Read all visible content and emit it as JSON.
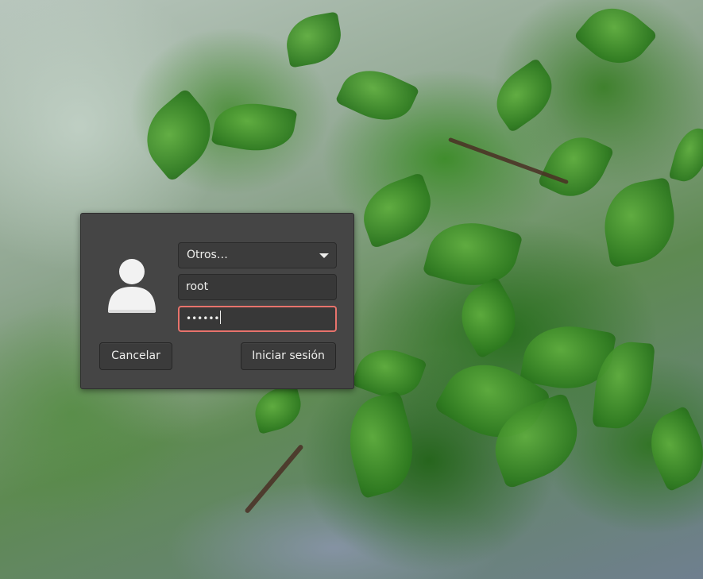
{
  "login_dialog": {
    "user_select": {
      "selected": "Otros…"
    },
    "username_field": {
      "value": "root"
    },
    "password_field": {
      "masked_value": "••••••"
    },
    "cancel_label": "Cancelar",
    "login_label": "Iniciar sesión"
  },
  "icons": {
    "avatar": "user-avatar-icon",
    "dropdown": "chevron-down-icon"
  },
  "colors": {
    "dialog_bg": "#454545",
    "field_bg": "#383838",
    "focus_border": "#e8736c",
    "text": "#eeeeec"
  }
}
